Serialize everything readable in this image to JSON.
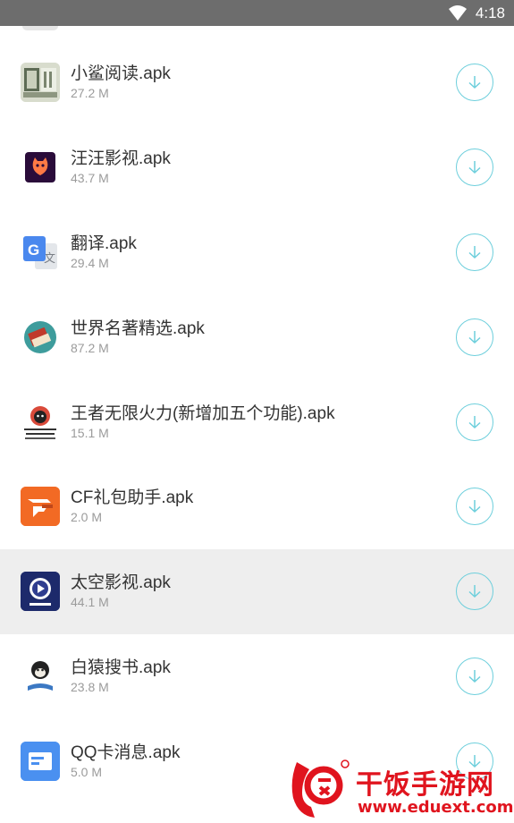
{
  "status_bar": {
    "time": "4:18"
  },
  "files": [
    {
      "name": "小鲨阅读.apk",
      "size": "27.2 M",
      "icon": "xiaosha-reader-icon",
      "selected": false
    },
    {
      "name": "汪汪影视.apk",
      "size": "43.7 M",
      "icon": "wangwang-video-icon",
      "selected": false
    },
    {
      "name": "翻译.apk",
      "size": "29.4 M",
      "icon": "google-translate-icon",
      "selected": false
    },
    {
      "name": "世界名著精选.apk",
      "size": "87.2 M",
      "icon": "world-classics-icon",
      "selected": false
    },
    {
      "name": "王者无限火力(新增加五个功能).apk",
      "size": "15.1 M",
      "icon": "wangzhe-meme-icon",
      "selected": false
    },
    {
      "name": "CF礼包助手.apk",
      "size": "2.0 M",
      "icon": "cf-gift-icon",
      "selected": false
    },
    {
      "name": "太空影视.apk",
      "size": "44.1 M",
      "icon": "taikong-video-icon",
      "selected": true
    },
    {
      "name": "白猿搜书.apk",
      "size": "23.8 M",
      "icon": "baiyuan-book-icon",
      "selected": false
    },
    {
      "name": "QQ卡消息.apk",
      "size": "5.0 M",
      "icon": "qq-card-icon",
      "selected": false
    }
  ],
  "colors": {
    "accent": "#6ecfdc",
    "status_bar": "#6d6d6d",
    "selected_row": "#eeeeee",
    "watermark": "#e0141e"
  },
  "watermark": {
    "title": "干饭手游网",
    "url": "www.eduext.com"
  }
}
